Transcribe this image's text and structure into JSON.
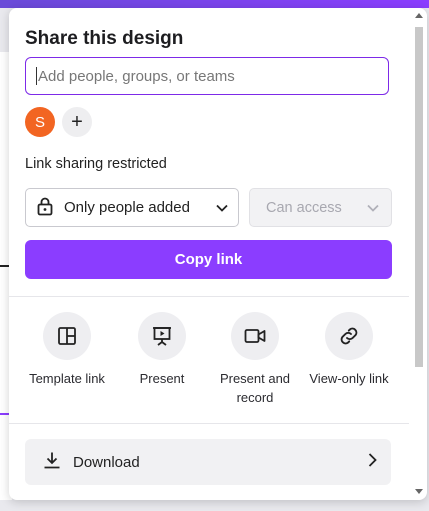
{
  "share_panel": {
    "title": "Share this design",
    "search": {
      "placeholder": "Add people, groups, or teams",
      "value": ""
    },
    "people": [
      {
        "initial": "S",
        "color": "#f26522"
      }
    ],
    "add_person_symbol": "+",
    "link_sharing_label": "Link sharing restricted",
    "access_select": {
      "value": "Only people added",
      "icon": "lock-icon"
    },
    "permission_select": {
      "value": "Can access",
      "disabled": true
    },
    "copy_link_label": "Copy link",
    "actions": [
      {
        "label": "Template link",
        "icon": "template-icon"
      },
      {
        "label": "Present",
        "icon": "present-icon"
      },
      {
        "label": "Present and record",
        "icon": "video-camera-icon"
      },
      {
        "label": "View-only link",
        "icon": "link-icon"
      }
    ],
    "download_label": "Download"
  },
  "colors": {
    "accent": "#8b3dff",
    "focus_border": "#7d2ae8",
    "avatar": "#f26522"
  }
}
